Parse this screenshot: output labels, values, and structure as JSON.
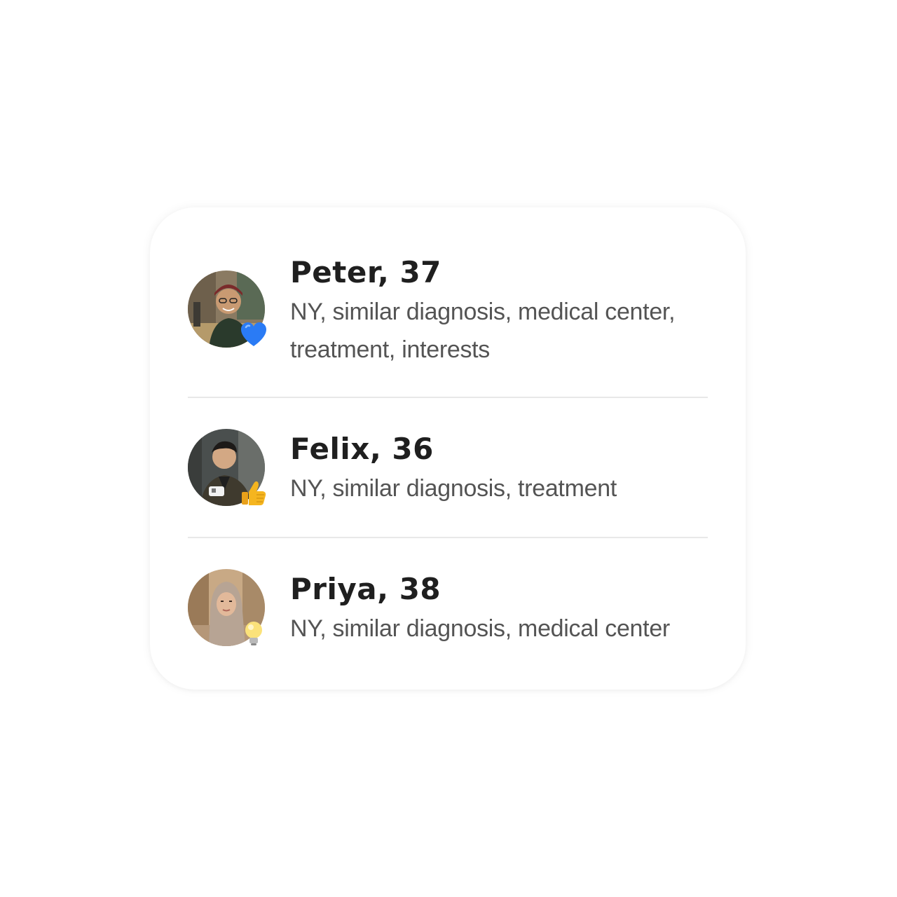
{
  "matches": [
    {
      "name": "Peter, 37",
      "description": "NY, similar diagnosis, medical center, treatment, interests",
      "reaction_icon": "blue-heart-icon",
      "reaction_color": "#2a7bf5"
    },
    {
      "name": "Felix, 36",
      "description": "NY, similar diagnosis, treatment",
      "reaction_icon": "thumbs-up-icon",
      "reaction_color": "#f5b51f"
    },
    {
      "name": "Priya, 38",
      "description": "NY, similar diagnosis, medical center",
      "reaction_icon": "light-bulb-icon",
      "reaction_color": "#f7d64a"
    }
  ]
}
